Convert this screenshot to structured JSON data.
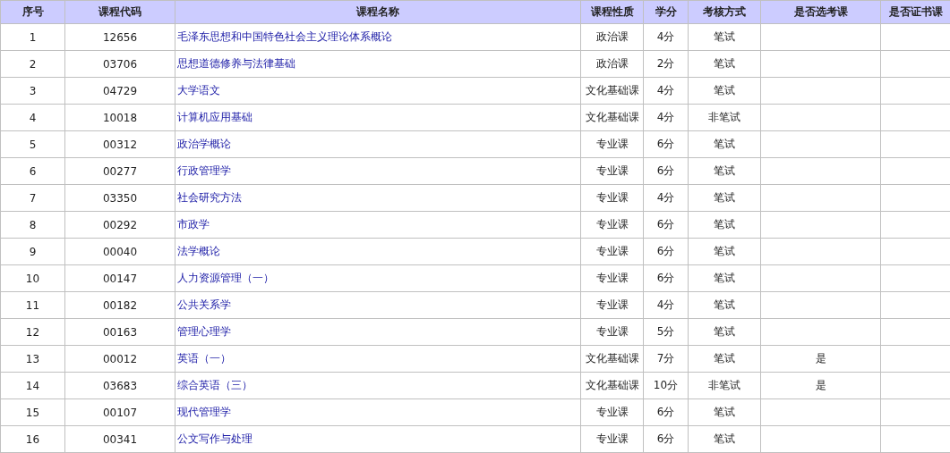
{
  "table": {
    "columns": [
      "序号",
      "课程代码",
      "课程名称",
      "课程性质",
      "学分",
      "考核方式",
      "是否选考课",
      "是否证书课"
    ],
    "rows": [
      {
        "no": "1",
        "code": "12656",
        "name": "毛泽东思想和中国特色社会主义理论体系概论",
        "type": "政治课",
        "credits": "4分",
        "exam": "笔试"
      },
      {
        "no": "2",
        "code": "03706",
        "name": "思想道德修养与法律基础",
        "type": "政治课",
        "credits": "2分",
        "exam": "笔试"
      },
      {
        "no": "3",
        "code": "04729",
        "name": "大学语文",
        "type": "文化基础课",
        "credits": "4分",
        "exam": "笔试"
      },
      {
        "no": "4",
        "code": "10018",
        "name": "计算机应用基础",
        "type": "文化基础课",
        "credits": "4分",
        "exam": "非笔试"
      },
      {
        "no": "5",
        "code": "00312",
        "name": "政治学概论",
        "type": "专业课",
        "credits": "6分",
        "exam": "笔试"
      },
      {
        "no": "6",
        "code": "00277",
        "name": "行政管理学",
        "type": "专业课",
        "credits": "6分",
        "exam": "笔试"
      },
      {
        "no": "7",
        "code": "03350",
        "name": "社会研究方法",
        "type": "专业课",
        "credits": "4分",
        "exam": "笔试"
      },
      {
        "no": "8",
        "code": "00292",
        "name": "市政学",
        "type": "专业课",
        "credits": "6分",
        "exam": "笔试"
      },
      {
        "no": "9",
        "code": "00040",
        "name": "法学概论",
        "type": "专业课",
        "credits": "6分",
        "exam": "笔试"
      },
      {
        "no": "10",
        "code": "00147",
        "name": "人力资源管理（一）",
        "type": "专业课",
        "credits": "6分",
        "exam": "笔试"
      },
      {
        "no": "11",
        "code": "00182",
        "name": "公共关系学",
        "type": "专业课",
        "credits": "4分",
        "exam": "笔试"
      },
      {
        "no": "12",
        "code": "00163",
        "name": "管理心理学",
        "type": "专业课",
        "credits": "5分",
        "exam": "笔试"
      },
      {
        "no": "13",
        "code": "00012",
        "name": "英语（一）",
        "type": "文化基础课",
        "credits": "7分",
        "exam": "笔试",
        "elective": "是"
      },
      {
        "no": "14",
        "code": "03683",
        "name": "综合英语（三）",
        "type": "文化基础课",
        "credits": "10分",
        "exam": "非笔试",
        "elective": "是"
      },
      {
        "no": "15",
        "code": "00107",
        "name": "现代管理学",
        "type": "专业课",
        "credits": "6分",
        "exam": "笔试"
      },
      {
        "no": "16",
        "code": "00341",
        "name": "公文写作与处理",
        "type": "专业课",
        "credits": "6分",
        "exam": "笔试"
      }
    ]
  }
}
